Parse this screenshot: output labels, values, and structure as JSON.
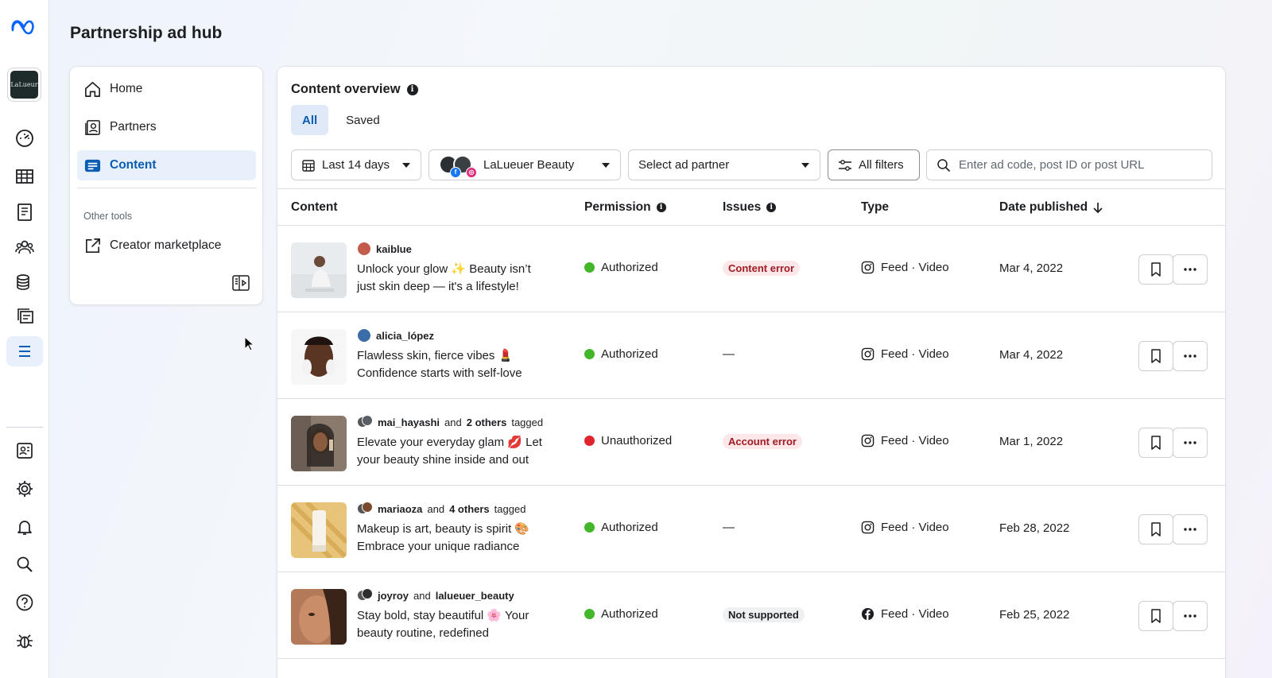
{
  "app": {
    "title": "Partnership ad hub",
    "brand_logo_text": "LaLueur"
  },
  "rail": {
    "icons": [
      "meta-logo-icon",
      "dashboard-icon",
      "table-icon",
      "catalog-icon",
      "audience-icon",
      "billing-icon",
      "creative-icon",
      "menu-icon",
      "account-icon",
      "settings-icon",
      "notifications-icon",
      "search-icon",
      "help-icon",
      "bug-report-icon"
    ]
  },
  "sidebar": {
    "items": [
      {
        "label": "Home",
        "icon": "home-icon"
      },
      {
        "label": "Partners",
        "icon": "partners-icon"
      },
      {
        "label": "Content",
        "icon": "content-icon",
        "active": true
      }
    ],
    "section_label": "Other tools",
    "tools": [
      {
        "label": "Creator marketplace",
        "icon": "external-link-icon"
      }
    ]
  },
  "main": {
    "title": "Content overview",
    "tabs": [
      {
        "label": "All",
        "active": true
      },
      {
        "label": "Saved"
      }
    ],
    "filters": {
      "date_range": "Last 14 days",
      "account": "LaLueuer Beauty",
      "ad_partner": "Select ad partner",
      "all_filters": "All filters",
      "search_placeholder": "Enter ad code, post ID or post URL"
    },
    "columns": {
      "content": "Content",
      "permission": "Permission",
      "issues": "Issues",
      "type": "Type",
      "date": "Date published"
    },
    "rows": [
      {
        "author": "kaiblue",
        "author_extra_and": "",
        "author_extra": "",
        "author_suffix": "",
        "caption": "Unlock your glow ✨ Beauty isn’t just skin deep — it's a lifestyle!",
        "permission": "Authorized",
        "permission_color": "#42b72a",
        "issue": "Content error",
        "issue_style": "err",
        "type": "Feed · Video",
        "platform": "instagram",
        "date": "Mar 4, 2022"
      },
      {
        "author": "alicia_lópez",
        "author_extra_and": "",
        "author_extra": "",
        "author_suffix": "",
        "caption": "Flawless skin, fierce vibes 💄 Confidence starts with self-love",
        "permission": "Authorized",
        "permission_color": "#42b72a",
        "issue": "—",
        "issue_style": "dash",
        "type": "Feed · Video",
        "platform": "instagram",
        "date": "Mar 4, 2022"
      },
      {
        "author": "mai_hayashi",
        "author_extra_and": "and",
        "author_extra": "2 others",
        "author_suffix": "tagged",
        "caption": "Elevate your everyday glam 💋 Let your beauty shine inside and out",
        "permission": "Unauthorized",
        "permission_color": "#e0242e",
        "issue": "Account error",
        "issue_style": "err",
        "type": "Feed · Video",
        "platform": "instagram",
        "date": "Mar 1, 2022"
      },
      {
        "author": "mariaoza",
        "author_extra_and": "and",
        "author_extra": "4 others",
        "author_suffix": "tagged",
        "caption": "Makeup is art, beauty is spirit 🎨 Embrace your unique radiance",
        "permission": "Authorized",
        "permission_color": "#42b72a",
        "issue": "—",
        "issue_style": "dash",
        "type": "Feed · Video",
        "platform": "instagram",
        "date": "Feb 28, 2022"
      },
      {
        "author": "joyroy",
        "author_extra_and": "and",
        "author_extra": "lalueuer_beauty",
        "author_suffix": "",
        "caption": "Stay bold, stay beautiful 🌸 Your beauty routine, redefined",
        "permission": "Authorized",
        "permission_color": "#42b72a",
        "issue": "Not supported",
        "issue_style": "neutral",
        "type": "Feed · Video",
        "platform": "facebook",
        "date": "Feb 25, 2022"
      }
    ]
  },
  "colors": {
    "accent": "#0a5db4",
    "active_bg": "#e7f0fb",
    "authorized": "#42b72a",
    "unauthorized": "#e0242e"
  }
}
